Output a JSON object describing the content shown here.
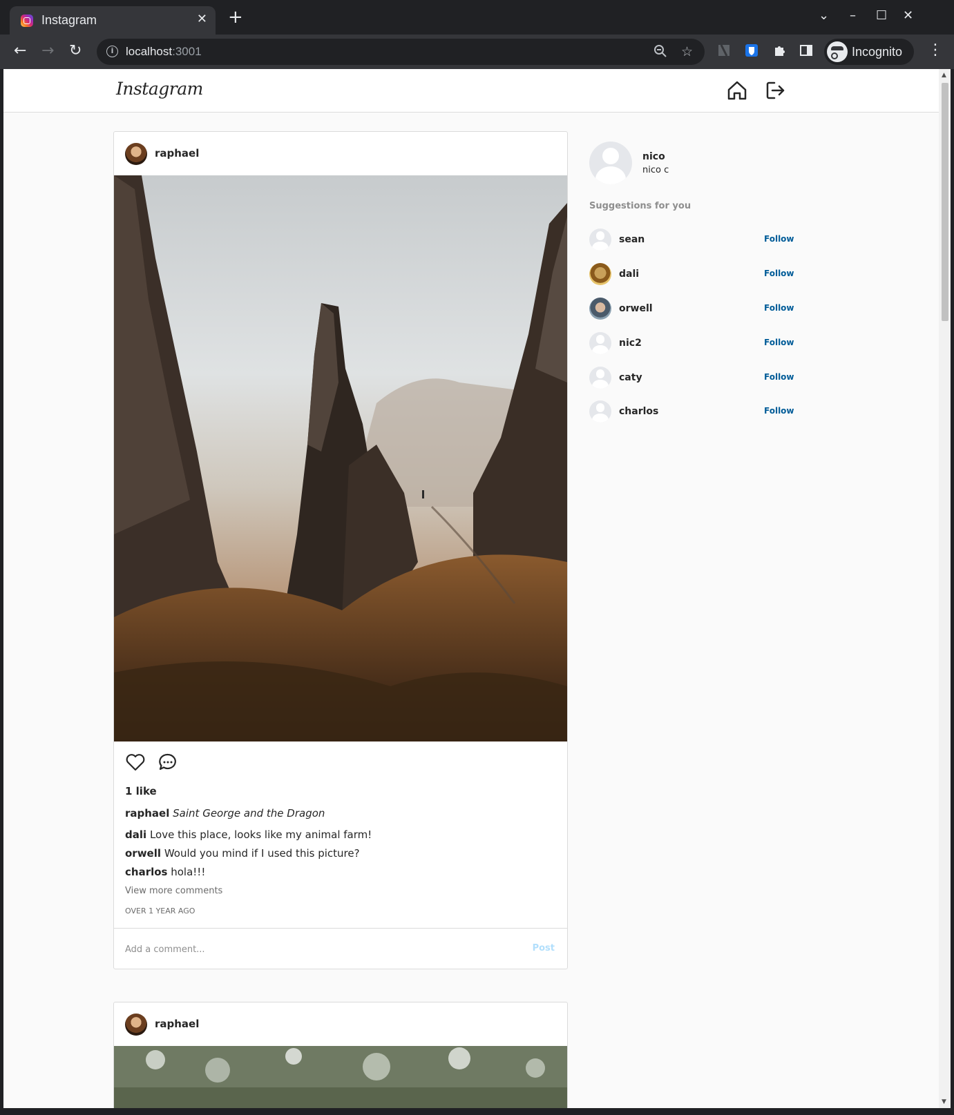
{
  "browser": {
    "tab_title": "Instagram",
    "tab_close": "✕",
    "new_tab": "+",
    "url_host": "localhost",
    "url_port": ":3001",
    "incognito_label": "Incognito"
  },
  "app": {
    "logo": "Instagram"
  },
  "posts": [
    {
      "username": "raphael",
      "likes": "1 like",
      "caption_user": "raphael",
      "caption_text": "Saint George and the Dragon",
      "comments": [
        {
          "user": "dali",
          "text": "Love this place, looks like my animal farm!"
        },
        {
          "user": "orwell",
          "text": "Would you mind if I used this picture?"
        },
        {
          "user": "charlos",
          "text": "hola!!!"
        }
      ],
      "view_more": "View more comments",
      "time_ago": "OVER 1 YEAR AGO",
      "comment_placeholder": "Add a comment...",
      "post_button": "Post"
    },
    {
      "username": "raphael"
    }
  ],
  "sidebar": {
    "username": "nico",
    "full_name": "nico c",
    "suggestions_title": "Suggestions for you",
    "suggestions": [
      {
        "name": "sean",
        "button": "Follow",
        "avatar": "default"
      },
      {
        "name": "dali",
        "button": "Follow",
        "avatar": "dali"
      },
      {
        "name": "orwell",
        "button": "Follow",
        "avatar": "orwell"
      },
      {
        "name": "nic2",
        "button": "Follow",
        "avatar": "default"
      },
      {
        "name": "caty",
        "button": "Follow",
        "avatar": "default"
      },
      {
        "name": "charlos",
        "button": "Follow",
        "avatar": "default"
      }
    ]
  },
  "colors": {
    "follow": "#005c98",
    "post_button": "#b2dffc",
    "border": "#dbdbdb",
    "background": "#fafafa"
  }
}
